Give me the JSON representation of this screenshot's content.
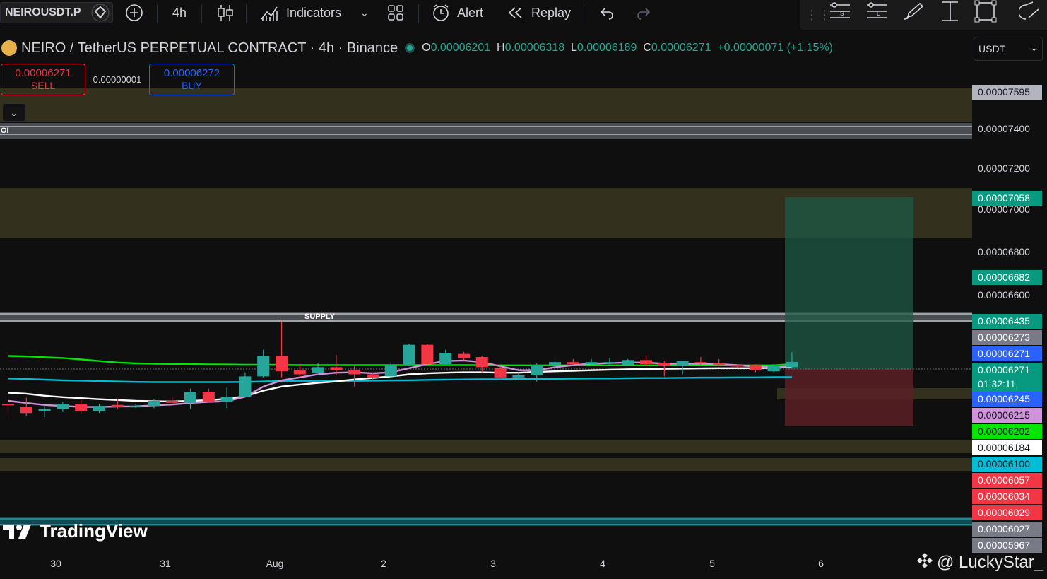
{
  "toolbar": {
    "symbol": "NEIROUSDT.P",
    "interval": "4h",
    "indicators_label": "Indicators",
    "alert_label": "Alert",
    "replay_label": "Replay"
  },
  "header": {
    "title": "NEIRO / TetherUS PERPETUAL CONTRACT · 4h · Binance",
    "o_key": "O",
    "o_val": "0.00006201",
    "h_key": "H",
    "h_val": "0.00006318",
    "l_key": "L",
    "l_val": "0.00006189",
    "c_key": "C",
    "c_val": "0.00006271",
    "change": "+0.00000071 (+1.15%)",
    "currency": "USDT"
  },
  "trade": {
    "sell_price": "0.00006271",
    "sell_label": "SELL",
    "spread": "0.00000001",
    "buy_price": "0.00006272",
    "buy_label": "BUY"
  },
  "labels": {
    "oi": "OI",
    "supply": "SUPPLY",
    "brand": "TradingView",
    "watermark": "@ LuckyStar_"
  },
  "price_axis": {
    "ticks": [
      "0.00007400",
      "0.00007200",
      "0.00007000",
      "0.00006800",
      "0.00006600"
    ],
    "tags": [
      {
        "text": "0.00007595",
        "bg": "#b2b5be",
        "fg": "#131722"
      },
      {
        "text": "0.00007058",
        "bg": "#089981",
        "fg": "#ffffff"
      },
      {
        "text": "0.00006682",
        "bg": "#089981",
        "fg": "#ffffff"
      },
      {
        "text": "0.00006435",
        "bg": "#089981",
        "fg": "#ffffff"
      },
      {
        "text": "0.00006273",
        "bg": "#787b86",
        "fg": "#ffffff"
      },
      {
        "text": "0.00006271",
        "bg": "#2962ff",
        "fg": "#ffffff"
      },
      {
        "text": "0.00006271",
        "bg": "#089981",
        "fg": "#ffffff",
        "sub": "01:32:11"
      },
      {
        "text": "0.00006245",
        "bg": "#2962ff",
        "fg": "#ffffff"
      },
      {
        "text": "0.00006215",
        "bg": "#ce93d8",
        "fg": "#131722"
      },
      {
        "text": "0.00006202",
        "bg": "#00e600",
        "fg": "#131722"
      },
      {
        "text": "0.00006184",
        "bg": "#ffffff",
        "fg": "#131722"
      },
      {
        "text": "0.00006100",
        "bg": "#00bcd4",
        "fg": "#131722"
      },
      {
        "text": "0.00006057",
        "bg": "#f23645",
        "fg": "#ffffff"
      },
      {
        "text": "0.00006034",
        "bg": "#f23645",
        "fg": "#ffffff"
      },
      {
        "text": "0.00006029",
        "bg": "#f23645",
        "fg": "#ffffff"
      },
      {
        "text": "0.00006027",
        "bg": "#787b86",
        "fg": "#ffffff"
      },
      {
        "text": "0.00005967",
        "bg": "#787b86",
        "fg": "#ffffff"
      }
    ]
  },
  "time_axis": {
    "ticks": [
      "30",
      "31",
      "Aug",
      "2",
      "3",
      "4",
      "5",
      "6"
    ]
  },
  "colors": {
    "up": "#26a69a",
    "down": "#f23645",
    "ma_green": "#00e600",
    "ma_white": "#ffffff",
    "ma_cyan": "#00bcd4",
    "ma_violet": "#ce93d8",
    "zone": "#3a3620"
  },
  "chart_data": {
    "type": "candlestick",
    "y_unit": "price (USDT)",
    "ylim": [
      5.97e-05,
      7.6e-05
    ],
    "candles": [
      {
        "o": 6.065e-05,
        "h": 6.075e-05,
        "l": 6.01e-05,
        "c": 6.06e-05
      },
      {
        "o": 6.05e-05,
        "h": 6.095e-05,
        "l": 6.005e-05,
        "c": 6.02e-05
      },
      {
        "o": 6.03e-05,
        "h": 6.06e-05,
        "l": 6e-05,
        "c": 6.04e-05
      },
      {
        "o": 6.04e-05,
        "h": 6.075e-05,
        "l": 6.025e-05,
        "c": 6.065e-05
      },
      {
        "o": 6.065e-05,
        "h": 6.085e-05,
        "l": 6.02e-05,
        "c": 6.03e-05
      },
      {
        "o": 6.03e-05,
        "h": 6.065e-05,
        "l": 6.02e-05,
        "c": 6.055e-05
      },
      {
        "o": 6.06e-05,
        "h": 6.09e-05,
        "l": 6.04e-05,
        "c": 6.05e-05
      },
      {
        "o": 6.05e-05,
        "h": 6.065e-05,
        "l": 6.045e-05,
        "c": 6.055e-05
      },
      {
        "o": 6.055e-05,
        "h": 6.09e-05,
        "l": 6.045e-05,
        "c": 6.08e-05
      },
      {
        "o": 6.08e-05,
        "h": 6.1e-05,
        "l": 6.06e-05,
        "c": 6.07e-05
      },
      {
        "o": 6.07e-05,
        "h": 6.14e-05,
        "l": 6.04e-05,
        "c": 6.125e-05
      },
      {
        "o": 6.125e-05,
        "h": 6.14e-05,
        "l": 6.07e-05,
        "c": 6.075e-05
      },
      {
        "o": 6.075e-05,
        "h": 6.145e-05,
        "l": 6.045e-05,
        "c": 6.1e-05
      },
      {
        "o": 6.1e-05,
        "h": 6.22e-05,
        "l": 6.095e-05,
        "c": 6.2e-05
      },
      {
        "o": 6.2e-05,
        "h": 6.33e-05,
        "l": 6.195e-05,
        "c": 6.3e-05
      },
      {
        "o": 6.3e-05,
        "h": 6.47e-05,
        "l": 6.195e-05,
        "c": 6.225e-05
      },
      {
        "o": 6.23e-05,
        "h": 6.26e-05,
        "l": 6.195e-05,
        "c": 6.21e-05
      },
      {
        "o": 6.215e-05,
        "h": 6.265e-05,
        "l": 6.205e-05,
        "c": 6.245e-05
      },
      {
        "o": 6.245e-05,
        "h": 6.305e-05,
        "l": 6.205e-05,
        "c": 6.23e-05
      },
      {
        "o": 6.23e-05,
        "h": 6.255e-05,
        "l": 6.15e-05,
        "c": 6.21e-05
      },
      {
        "o": 6.21e-05,
        "h": 6.22e-05,
        "l": 6.175e-05,
        "c": 6.195e-05
      },
      {
        "o": 6.2e-05,
        "h": 6.27e-05,
        "l": 6.19e-05,
        "c": 6.255e-05
      },
      {
        "o": 6.255e-05,
        "h": 6.36e-05,
        "l": 6.25e-05,
        "c": 6.355e-05
      },
      {
        "o": 6.355e-05,
        "h": 6.36e-05,
        "l": 6.255e-05,
        "c": 6.26e-05
      },
      {
        "o": 6.26e-05,
        "h": 6.33e-05,
        "l": 6.255e-05,
        "c": 6.315e-05
      },
      {
        "o": 6.31e-05,
        "h": 6.32e-05,
        "l": 6.28e-05,
        "c": 6.29e-05
      },
      {
        "o": 6.295e-05,
        "h": 6.3e-05,
        "l": 6.22e-05,
        "c": 6.245e-05
      },
      {
        "o": 6.24e-05,
        "h": 6.25e-05,
        "l": 6.185e-05,
        "c": 6.195e-05
      },
      {
        "o": 6.195e-05,
        "h": 6.22e-05,
        "l": 6.185e-05,
        "c": 6.205e-05
      },
      {
        "o": 6.205e-05,
        "h": 6.265e-05,
        "l": 6.175e-05,
        "c": 6.255e-05
      },
      {
        "o": 6.255e-05,
        "h": 6.29e-05,
        "l": 6.245e-05,
        "c": 6.27e-05
      },
      {
        "o": 6.27e-05,
        "h": 6.285e-05,
        "l": 6.255e-05,
        "c": 6.26e-05
      },
      {
        "o": 6.26e-05,
        "h": 6.285e-05,
        "l": 6.25e-05,
        "c": 6.27e-05
      },
      {
        "o": 6.265e-05,
        "h": 6.29e-05,
        "l": 6.25e-05,
        "c": 6.27e-05
      },
      {
        "o": 6.255e-05,
        "h": 6.285e-05,
        "l": 6.25e-05,
        "c": 6.28e-05
      },
      {
        "o": 6.28e-05,
        "h": 6.3e-05,
        "l": 6.25e-05,
        "c": 6.26e-05
      },
      {
        "o": 6.265e-05,
        "h": 6.275e-05,
        "l": 6.2e-05,
        "c": 6.25e-05
      },
      {
        "o": 6.25e-05,
        "h": 6.275e-05,
        "l": 6.21e-05,
        "c": 6.275e-05
      },
      {
        "o": 6.27e-05,
        "h": 6.295e-05,
        "l": 6.255e-05,
        "c": 6.265e-05
      },
      {
        "o": 6.265e-05,
        "h": 6.285e-05,
        "l": 6.25e-05,
        "c": 6.255e-05
      },
      {
        "o": 6.255e-05,
        "h": 6.26e-05,
        "l": 6.24e-05,
        "c": 6.25e-05
      },
      {
        "o": 6.255e-05,
        "h": 6.26e-05,
        "l": 6.22e-05,
        "c": 6.23e-05
      },
      {
        "o": 6.225e-05,
        "h": 6.26e-05,
        "l": 6.22e-05,
        "c": 6.25e-05
      },
      {
        "o": 6.245e-05,
        "h": 6.318e-05,
        "l": 6.24e-05,
        "c": 6.271e-05
      }
    ],
    "moving_averages": [
      {
        "color": "#00e600",
        "values": [
          6.3e-05,
          6.298e-05,
          6.294e-05,
          6.29e-05,
          6.283e-05,
          6.275e-05,
          6.268e-05,
          6.264e-05,
          6.262e-05,
          6.261e-05,
          6.26e-05,
          6.259e-05,
          6.258e-05,
          6.257e-05,
          6.257e-05,
          6.256e-05,
          6.255e-05,
          6.255e-05,
          6.255e-05,
          6.255e-05,
          6.255e-05,
          6.255e-05,
          6.255e-05,
          6.255e-05,
          6.255e-05,
          6.255e-05,
          6.255e-05,
          6.254e-05,
          6.254e-05,
          6.254e-05,
          6.254e-05,
          6.254e-05,
          6.254e-05,
          6.254e-05,
          6.254e-05,
          6.254e-05,
          6.254e-05,
          6.254e-05,
          6.254e-05,
          6.254e-05,
          6.254e-05,
          6.254e-05,
          6.254e-05,
          6.26e-05
        ]
      },
      {
        "color": "#00bcd4",
        "values": [
          6.19e-05,
          6.187e-05,
          6.184e-05,
          6.181e-05,
          6.179e-05,
          6.177e-05,
          6.175e-05,
          6.173e-05,
          6.172e-05,
          6.172e-05,
          6.172e-05,
          6.172e-05,
          6.172e-05,
          6.173e-05,
          6.175e-05,
          6.177e-05,
          6.178e-05,
          6.178e-05,
          6.178e-05,
          6.178e-05,
          6.179e-05,
          6.18e-05,
          6.181e-05,
          6.183e-05,
          6.184e-05,
          6.185e-05,
          6.186e-05,
          6.186e-05,
          6.187e-05,
          6.187e-05,
          6.188e-05,
          6.189e-05,
          6.19e-05,
          6.19e-05,
          6.191e-05,
          6.192e-05,
          6.192e-05,
          6.193e-05,
          6.194e-05,
          6.194e-05,
          6.195e-05,
          6.195e-05,
          6.196e-05,
          6.196e-05
        ]
      },
      {
        "color": "#ffffff",
        "values": [
          6.12e-05,
          6.115e-05,
          6.105e-05,
          6.098e-05,
          6.093e-05,
          6.088e-05,
          6.084e-05,
          6.08e-05,
          6.078e-05,
          6.077e-05,
          6.08e-05,
          6.083e-05,
          6.09e-05,
          6.102e-05,
          6.13e-05,
          6.15e-05,
          6.16e-05,
          6.168e-05,
          6.175e-05,
          6.185e-05,
          6.192e-05,
          6.2e-05,
          6.21e-05,
          6.215e-05,
          6.218e-05,
          6.22e-05,
          6.22e-05,
          6.218e-05,
          6.218e-05,
          6.222e-05,
          6.225e-05,
          6.227e-05,
          6.23e-05,
          6.233e-05,
          6.235e-05,
          6.236e-05,
          6.237e-05,
          6.238e-05,
          6.239e-05,
          6.24e-05,
          6.24e-05,
          6.24e-05,
          6.242e-05,
          6.245e-05
        ]
      },
      {
        "color": "#ce93d8",
        "values": [
          6.08e-05,
          6.07e-05,
          6.06e-05,
          6.055e-05,
          6.05e-05,
          6.05e-05,
          6.052e-05,
          6.053e-05,
          6.058e-05,
          6.062e-05,
          6.07e-05,
          6.075e-05,
          6.078e-05,
          6.1e-05,
          6.15e-05,
          6.18e-05,
          6.195e-05,
          6.21e-05,
          6.218e-05,
          6.22e-05,
          6.215e-05,
          6.22e-05,
          6.24e-05,
          6.26e-05,
          6.275e-05,
          6.278e-05,
          6.27e-05,
          6.25e-05,
          6.23e-05,
          6.23e-05,
          6.245e-05,
          6.255e-05,
          6.262e-05,
          6.265e-05,
          6.268e-05,
          6.268e-05,
          6.262e-05,
          6.262e-05,
          6.262e-05,
          6.26e-05,
          6.255e-05,
          6.248e-05,
          6.245e-05,
          6.25e-05
        ]
      }
    ]
  }
}
